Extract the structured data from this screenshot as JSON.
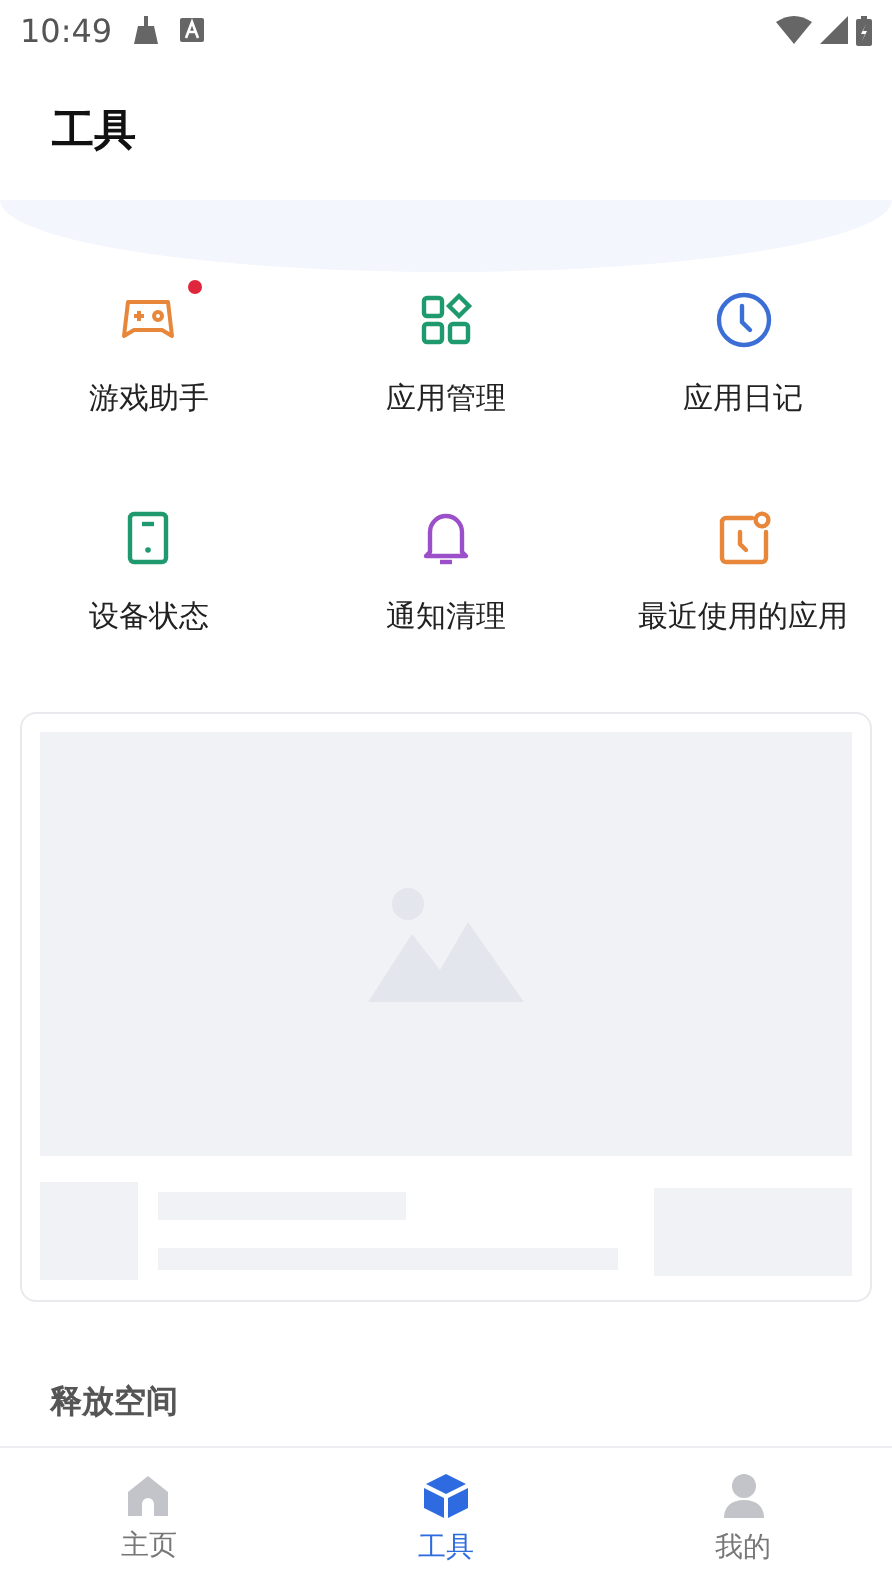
{
  "status_bar": {
    "time": "10:49"
  },
  "header": {
    "title": "工具"
  },
  "tools": [
    {
      "label": "游戏助手",
      "kind": "gamepad",
      "color": "#e8873a",
      "badge": true
    },
    {
      "label": "应用管理",
      "kind": "apps",
      "color": "#1f9a6e",
      "badge": false
    },
    {
      "label": "应用日记",
      "kind": "clock",
      "color": "#3b6fd6",
      "badge": false
    },
    {
      "label": "设备状态",
      "kind": "phone",
      "color": "#1f9a6e",
      "badge": false
    },
    {
      "label": "通知清理",
      "kind": "bell",
      "color": "#9b4fc8",
      "badge": false
    },
    {
      "label": "最近使用的应用",
      "kind": "recent",
      "color": "#e8873a",
      "badge": false
    }
  ],
  "section": {
    "title": "释放空间"
  },
  "nav": [
    {
      "label": "主页",
      "kind": "home",
      "selected": false
    },
    {
      "label": "工具",
      "kind": "cube",
      "selected": true
    },
    {
      "label": "我的",
      "kind": "person",
      "selected": false
    }
  ]
}
